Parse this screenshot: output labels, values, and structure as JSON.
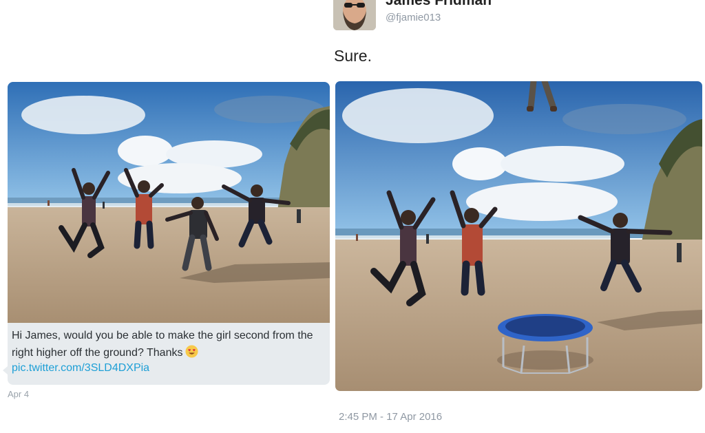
{
  "reply": {
    "author_name": "James Fridman",
    "author_handle": "@fjamie013",
    "text": "Sure.",
    "timestamp": "2:45 PM - 17 Apr 2016",
    "avatar_icon": "bearded-man-avatar"
  },
  "original_message": {
    "text": "Hi James, would you be able to make the girl second from the right higher off the ground? Thanks",
    "emoji_icon": "smiling-face-with-heart-eyes-icon",
    "link": "pic.twitter.com/3SLD4DXPia",
    "date": "Apr 4"
  },
  "colors": {
    "link": "#1d9fd6",
    "bubble_background": "#e7ebee",
    "meta_text": "#8f98a3",
    "trampoline_mat": "#1f3f86",
    "trampoline_rim": "#2f64c8"
  }
}
